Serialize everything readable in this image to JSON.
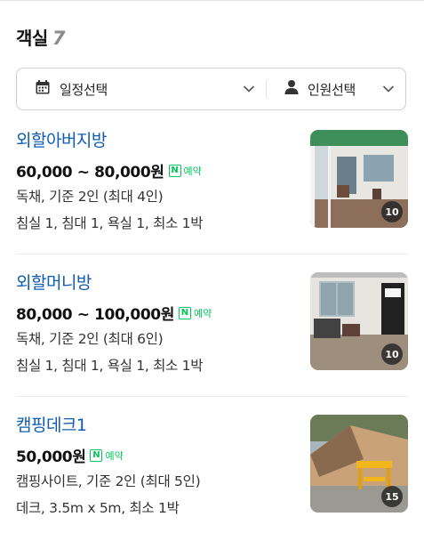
{
  "header": {
    "title": "객실",
    "count": "7"
  },
  "filter": {
    "date_label": "일정선택",
    "guest_label": "인원선택"
  },
  "badge_label": "예약",
  "badge_letter": "N",
  "rooms": [
    {
      "name": "외할아버지방",
      "price": "60,000 ~ 80,000원",
      "line1": "독채, 기준 2인 (최대 4인)",
      "line2": "침실 1, 침대 1, 욕실 1, 최소 1박",
      "photo_count": "10"
    },
    {
      "name": "외할머니방",
      "price": "80,000 ~ 100,000원",
      "line1": "독채, 기준 2인 (최대 6인)",
      "line2": "침실 1, 침대 1, 욕실 1, 최소 1박",
      "photo_count": "10"
    },
    {
      "name": "캠핑데크1",
      "price": "50,000원",
      "line1": "캠핑사이트, 기준 2인 (최대 5인)",
      "line2": "데크, 3.5m x 5m, 최소 1박",
      "photo_count": "15"
    }
  ]
}
